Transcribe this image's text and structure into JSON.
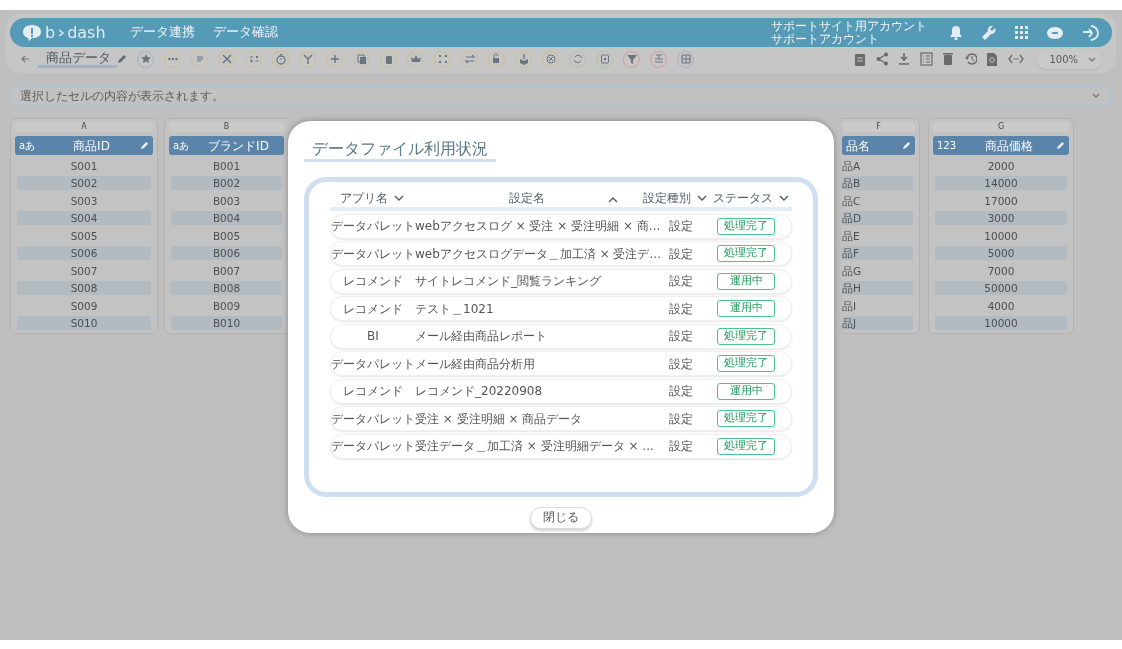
{
  "header": {
    "logo": {
      "left": "b",
      "right": "dash"
    },
    "nav": [
      {
        "label": "データ連携"
      },
      {
        "label": "データ確認"
      }
    ],
    "account": {
      "site": "サポートサイト用アカウント",
      "user": "サポートアカウント"
    }
  },
  "toolbar": {
    "tab": {
      "label": "商品データ",
      "selected": true
    },
    "zoom": "100%"
  },
  "cell_viewer": {
    "placeholder": "選択したセルの内容が表示されます。"
  },
  "grid": {
    "columns": [
      {
        "letter": "A",
        "type_label": "aあ",
        "title": "商品ID",
        "editable": true,
        "cells": [
          "S001",
          "S002",
          "S003",
          "S004",
          "S005",
          "S006",
          "S007",
          "S008",
          "S009",
          "S010"
        ]
      },
      {
        "letter": "B",
        "type_label": "aあ",
        "title": "ブランドID",
        "editable": false,
        "cells": [
          "B001",
          "B002",
          "B003",
          "B004",
          "B005",
          "B006",
          "B007",
          "B008",
          "B009",
          "B010"
        ]
      },
      {
        "letter": "F",
        "title": "品名",
        "editable": true,
        "cells": [
          "品A",
          "品B",
          "品C",
          "品D",
          "品E",
          "品F",
          "品G",
          "品H",
          "品I",
          "品J"
        ]
      },
      {
        "letter": "G",
        "type_label": "123",
        "title": "商品価格",
        "editable": true,
        "cells": [
          "2000",
          "14000",
          "17000",
          "3000",
          "10000",
          "5000",
          "7000",
          "50000",
          "4000",
          "10000"
        ]
      }
    ]
  },
  "dialog": {
    "title": "データファイル利用状況",
    "columns": [
      {
        "label": "アプリ名",
        "ascending": false
      },
      {
        "label": "設定名",
        "ascending": true
      },
      {
        "label": "設定種別",
        "ascending": false
      },
      {
        "label": "ステータス",
        "ascending": false
      }
    ],
    "rows": [
      {
        "app": "データパレット",
        "name": "webアクセスログ × 受注 × 受注明細 × 商...",
        "kind": "設定",
        "status": "処理完了"
      },
      {
        "app": "データパレット",
        "name": "webアクセスログデータ＿加工済 × 受注デ...",
        "kind": "設定",
        "status": "処理完了"
      },
      {
        "app": "レコメンド",
        "name": "サイトレコメンド_閲覧ランキング",
        "kind": "設定",
        "status": "運用中"
      },
      {
        "app": "レコメンド",
        "name": "テスト＿1021",
        "kind": "設定",
        "status": "運用中"
      },
      {
        "app": "BI",
        "name": "メール経由商品レポート",
        "kind": "設定",
        "status": "処理完了"
      },
      {
        "app": "データパレット",
        "name": "メール経由商品分析用",
        "kind": "設定",
        "status": "処理完了"
      },
      {
        "app": "レコメンド",
        "name": "レコメンド_20220908",
        "kind": "設定",
        "status": "運用中"
      },
      {
        "app": "データパレット",
        "name": "受注 × 受注明細 × 商品データ",
        "kind": "設定",
        "status": "処理完了"
      },
      {
        "app": "データパレット",
        "name": "受注データ＿加工済 × 受注明細データ × ...",
        "kind": "設定",
        "status": "処理完了"
      }
    ],
    "close_button": "閉じる"
  }
}
